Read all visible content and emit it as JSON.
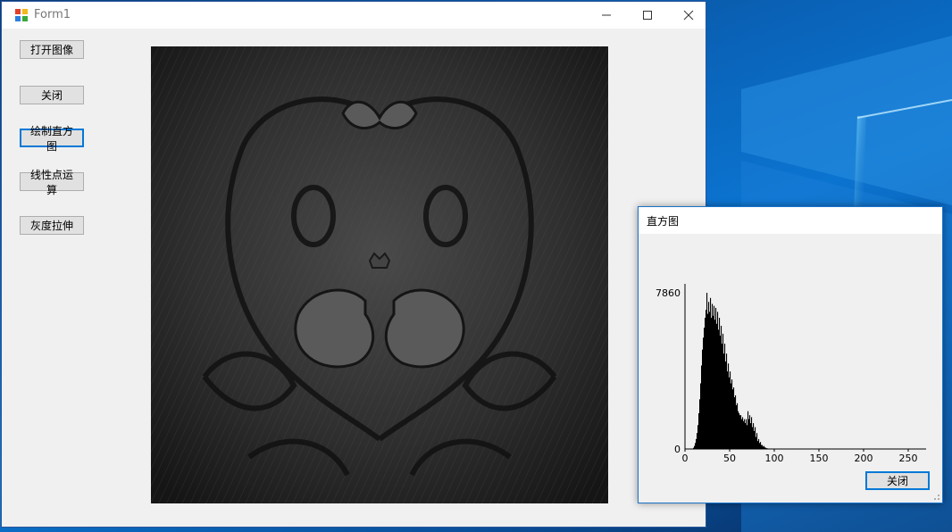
{
  "window": {
    "title": "Form1"
  },
  "buttons": {
    "open_image": "打开图像",
    "close": "关闭",
    "draw_histogram": "绘制直方图",
    "linear_point_op": "线性点运算",
    "gray_stretch": "灰度拉伸"
  },
  "histogram_dialog": {
    "title": "直方图",
    "close_button": "关闭"
  },
  "colors": {
    "accent": "#0078d7",
    "desktop": "#0a63b8"
  },
  "chart_data": {
    "type": "bar",
    "xlim": [
      0,
      270
    ],
    "ylim": [
      0,
      7860
    ],
    "x_ticks": [
      0,
      50,
      100,
      150,
      200,
      250
    ],
    "y_tick_labels": [
      "7860",
      "0"
    ],
    "bins": [
      [
        0,
        0
      ],
      [
        1,
        0
      ],
      [
        2,
        0
      ],
      [
        3,
        0
      ],
      [
        4,
        0
      ],
      [
        5,
        0
      ],
      [
        6,
        0
      ],
      [
        7,
        0
      ],
      [
        8,
        20
      ],
      [
        9,
        60
      ],
      [
        10,
        150
      ],
      [
        11,
        300
      ],
      [
        12,
        500
      ],
      [
        13,
        800
      ],
      [
        14,
        1200
      ],
      [
        15,
        1800
      ],
      [
        16,
        2500
      ],
      [
        17,
        3300
      ],
      [
        18,
        4200
      ],
      [
        19,
        5000
      ],
      [
        20,
        5600
      ],
      [
        21,
        6100
      ],
      [
        22,
        6600
      ],
      [
        23,
        7000
      ],
      [
        24,
        7860
      ],
      [
        25,
        6800
      ],
      [
        26,
        7400
      ],
      [
        27,
        6900
      ],
      [
        28,
        7600
      ],
      [
        29,
        6600
      ],
      [
        30,
        7300
      ],
      [
        31,
        6700
      ],
      [
        32,
        7200
      ],
      [
        33,
        6500
      ],
      [
        34,
        7100
      ],
      [
        35,
        6300
      ],
      [
        36,
        6900
      ],
      [
        37,
        6000
      ],
      [
        38,
        6600
      ],
      [
        39,
        5700
      ],
      [
        40,
        6200
      ],
      [
        41,
        5300
      ],
      [
        42,
        5800
      ],
      [
        43,
        4800
      ],
      [
        44,
        5300
      ],
      [
        45,
        4400
      ],
      [
        46,
        4800
      ],
      [
        47,
        3900
      ],
      [
        48,
        4300
      ],
      [
        49,
        3600
      ],
      [
        50,
        3900
      ],
      [
        51,
        3300
      ],
      [
        52,
        3500
      ],
      [
        53,
        3000
      ],
      [
        54,
        3100
      ],
      [
        55,
        2600
      ],
      [
        56,
        2700
      ],
      [
        57,
        2200
      ],
      [
        58,
        2300
      ],
      [
        59,
        1900
      ],
      [
        60,
        1800
      ],
      [
        61,
        1700
      ],
      [
        62,
        1700
      ],
      [
        63,
        1500
      ],
      [
        64,
        1600
      ],
      [
        65,
        1400
      ],
      [
        66,
        1500
      ],
      [
        67,
        1300
      ],
      [
        68,
        1500
      ],
      [
        69,
        1200
      ],
      [
        70,
        1900
      ],
      [
        71,
        1500
      ],
      [
        72,
        1700
      ],
      [
        73,
        1300
      ],
      [
        74,
        1600
      ],
      [
        75,
        1100
      ],
      [
        76,
        1300
      ],
      [
        77,
        900
      ],
      [
        78,
        1100
      ],
      [
        79,
        600
      ],
      [
        80,
        800
      ],
      [
        81,
        400
      ],
      [
        82,
        500
      ],
      [
        83,
        300
      ],
      [
        84,
        350
      ],
      [
        85,
        200
      ],
      [
        86,
        200
      ],
      [
        87,
        120
      ],
      [
        88,
        150
      ],
      [
        89,
        80
      ],
      [
        90,
        60
      ],
      [
        91,
        40
      ],
      [
        92,
        30
      ],
      [
        93,
        20
      ],
      [
        94,
        10
      ],
      [
        95,
        5
      ]
    ]
  }
}
